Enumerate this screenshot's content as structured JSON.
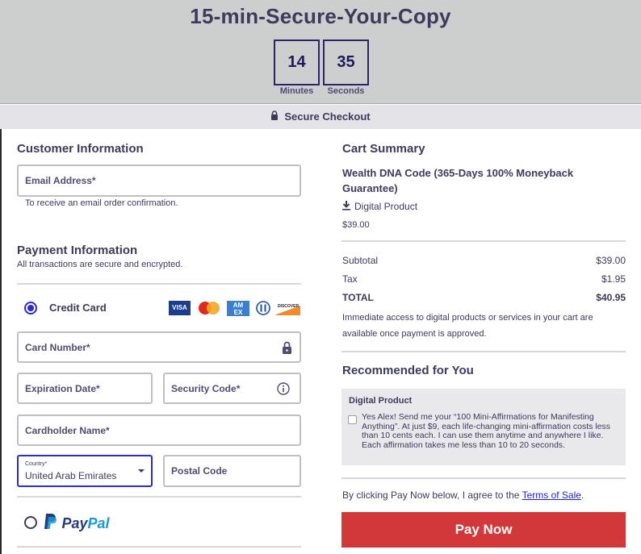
{
  "timer": {
    "title": "15-min-Secure-Your-Copy",
    "minutes": "14",
    "seconds": "35",
    "minutes_label": "Minutes",
    "seconds_label": "Seconds"
  },
  "secure_bar": {
    "label": "Secure Checkout",
    "icon": "lock-icon"
  },
  "customer": {
    "heading": "Customer Information",
    "email_label": "Email Address*",
    "email_hint": "To receive an email order confirmation."
  },
  "payment": {
    "heading": "Payment Information",
    "subtext": "All transactions are secure and encrypted.",
    "credit_card_label": "Credit Card",
    "card_brands": [
      "VISA",
      "Mastercard",
      "AMEX",
      "Diners Club",
      "DISCOVER"
    ],
    "card_number_label": "Card Number*",
    "expiration_label": "Expiration Date*",
    "security_code_label": "Security Code*",
    "cardholder_label": "Cardholder Name*",
    "country_label": "Country*",
    "country_value": "United Arab Emirates",
    "postal_label": "Postal Code",
    "paypal_pay": "Pay",
    "paypal_pal": "Pal",
    "selected_method": "credit_card"
  },
  "cart": {
    "heading": "Cart Summary",
    "product_name": "Wealth DNA Code (365-Days 100% Moneyback Guarantee)",
    "product_type": "Digital Product",
    "product_price": "$39.00",
    "subtotal_label": "Subtotal",
    "subtotal_value": "$39.00",
    "tax_label": "Tax",
    "tax_value": "$1.95",
    "total_label": "TOTAL",
    "total_value": "$40.95",
    "notice": "Immediate access to digital products or services in your cart are available once payment is approved."
  },
  "recommended": {
    "heading": "Recommended for You",
    "type": "Digital Product",
    "offer_text": "Yes Alex! Send me your “100 Mini-Affirmations for Manifesting Anything”. At just $9, each life-changing mini-affirmation costs less than 10 cents each. I can use them anytime and anywhere I like. Each affirmation takes me less than 10 to 20 seconds.",
    "checked": false
  },
  "terms": {
    "prefix": "By clicking Pay Now below, I agree to the ",
    "link": "Terms of Sale",
    "suffix": "."
  },
  "pay_button": "Pay Now",
  "colors": {
    "accent": "#2a2ad4",
    "pay_button": "#d2373a",
    "header_bg": "#cdcfcf",
    "text": "#3d3a5c"
  }
}
